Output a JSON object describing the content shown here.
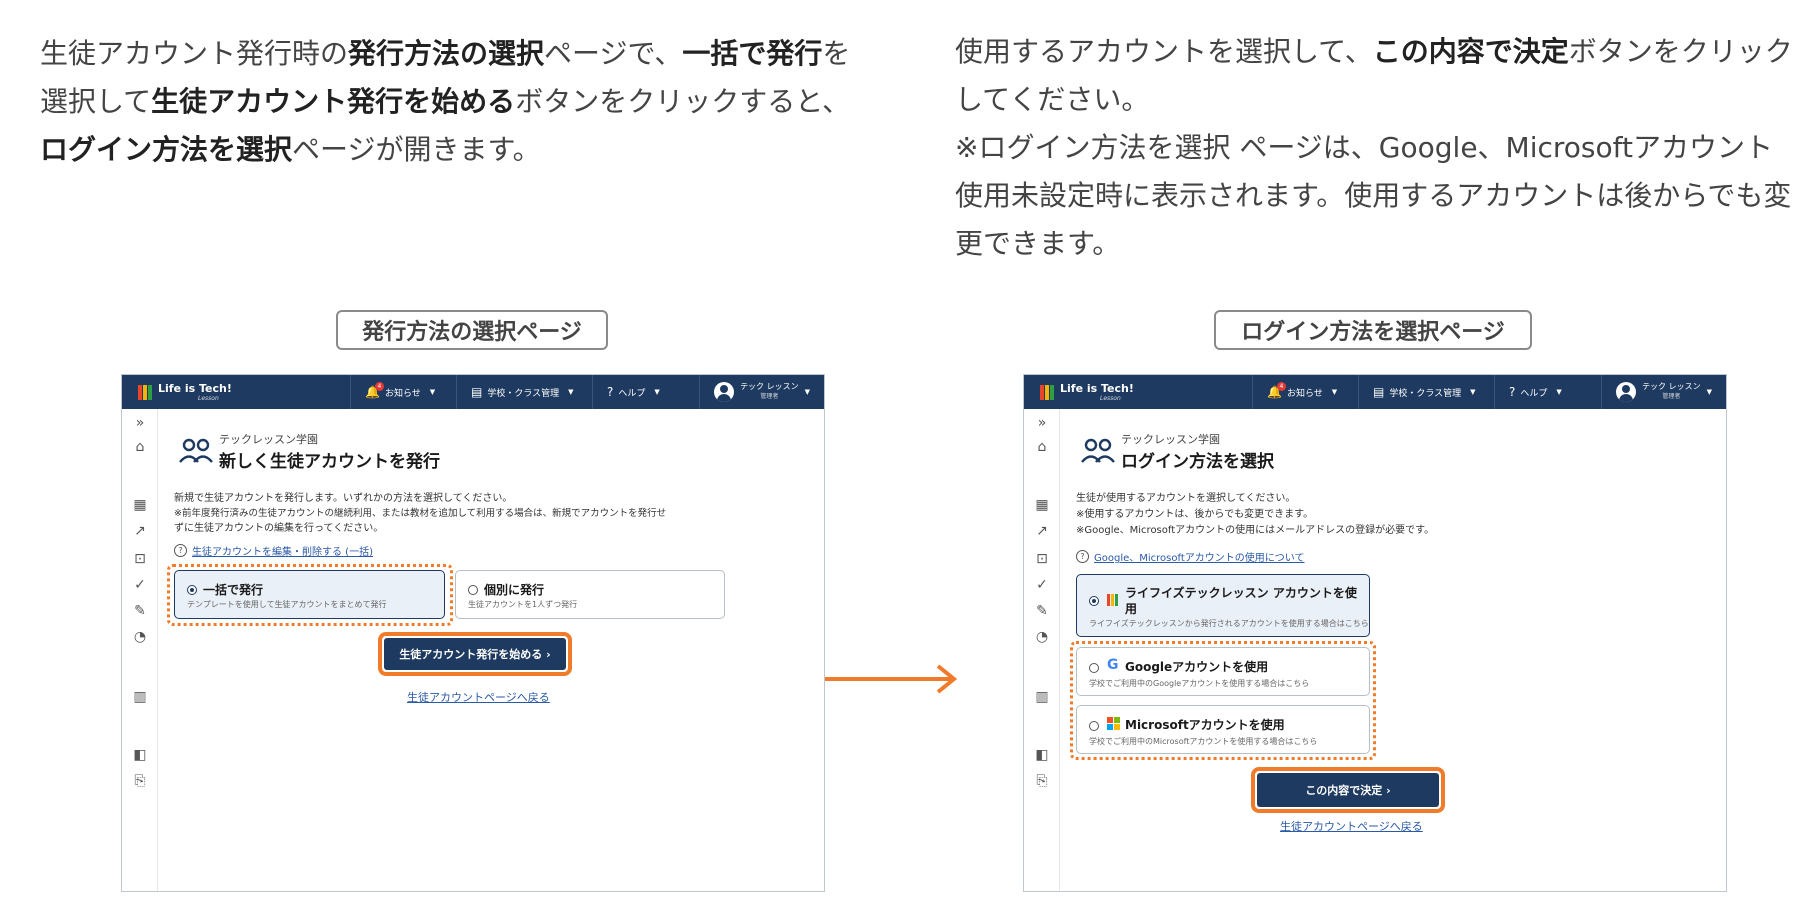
{
  "intro_left": {
    "p1": "生徒アカウント発行時の",
    "b1": "発行方法の選択",
    "p2": "ページで、",
    "b2": "一括で発行",
    "p3": "を選択して",
    "b3": "生徒アカウント発行を始める",
    "p4": "ボタンをクリックすると、",
    "b4": "ログイン方法を選択",
    "p5": "ページが開きます。"
  },
  "intro_right": {
    "p1": "使用するアカウントを選択して、",
    "b1": "この内容で決定",
    "p2": "ボタンをクリックしてください。",
    "note": "※ログイン方法を選択 ページは、Google、Microsoftアカウント使用未設定時に表示されます。使用するアカウントは後からでも変更できます。"
  },
  "captions": {
    "left": "発行方法の選択ページ",
    "right": "ログイン方法を選択ページ"
  },
  "topbar": {
    "logo": "Life is Tech!",
    "logo_sub": "Lesson",
    "notice": "お知らせ",
    "notice_count": "4",
    "school": "学校・クラス管理",
    "help": "ヘルプ",
    "user_name": "テック レッスン",
    "user_role": "管理者"
  },
  "left_page": {
    "org": "テックレッスン学園",
    "title": "新しく生徒アカウントを発行",
    "desc1": "新規で生徒アカウントを発行します。いずれかの方法を選択してください。",
    "desc2": "※前年度発行済みの生徒アカウントの継続利用、または教材を追加して利用する場合は、新規でアカウントを発行せ",
    "desc3": "ずに生徒アカウントの編集を行ってください。",
    "help_link": "生徒アカウントを編集・削除する (一括)",
    "opt1_label": "一括で発行",
    "opt1_sub": "テンプレートを使用して生徒アカウントをまとめて発行",
    "opt2_label": "個別に発行",
    "opt2_sub": "生徒アカウントを1人ずつ発行",
    "start_button": "生徒アカウント発行を始める ›",
    "back_link": "生徒アカウントページへ戻る"
  },
  "right_page": {
    "org": "テックレッスン学園",
    "title": "ログイン方法を選択",
    "desc1": "生徒が使用するアカウントを選択してください。",
    "desc2": "※使用するアカウントは、後からでも変更できます。",
    "desc3": "※Google、Microsoftアカウントの使用にはメールアドレスの登録が必要です。",
    "help_link": "Google、Microsoftアカウントの使用について",
    "opt1_label": "ライフイズテックレッスン アカウントを使用",
    "opt1_sub": "ライフイズテックレッスンから発行されるアカウントを使用する場合はこちら",
    "opt2_label": "Googleアカウントを使用",
    "opt2_sub": "学校でご利用中のGoogleアカウントを使用する場合はこちら",
    "opt3_label": "Microsoftアカウントを使用",
    "opt3_sub": "学校でご利用中のMicrosoftアカウントを使用する場合はこちら",
    "decide_button": "この内容で決定 ›",
    "back_link": "生徒アカウントページへ戻る"
  },
  "colors": {
    "navy": "#1e3a60",
    "accent_orange": "#f07b2a",
    "link_blue": "#2a5aa8"
  }
}
